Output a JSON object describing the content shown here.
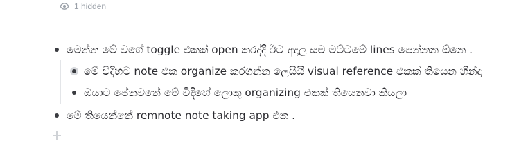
{
  "hidden_indicator": {
    "icon": "eye-icon",
    "text": "1 hidden"
  },
  "bullets": [
    {
      "text": "මෙන්න මේ වගේ toggle එකක් open කරද්දි ඊට අදාල සම මට්ටමේ lines පෙන්නන ඕනෙ .",
      "children": [
        {
          "text": "මේ විදිහට note එක organize කරගන්න ලෙසියි visual reference එකක් තියෙන හින්දා"
        },
        {
          "text": "ඔයාට පේනවනේ මේ විදිහේ ලොකු organizing එකක් තියෙනවා කියලා"
        }
      ]
    },
    {
      "text": "මේ තියෙන්නේ remnote note taking app එක ."
    }
  ],
  "colors": {
    "text": "#2b2b30",
    "muted": "#9aa0a8",
    "guide": "#e3e5e8"
  }
}
